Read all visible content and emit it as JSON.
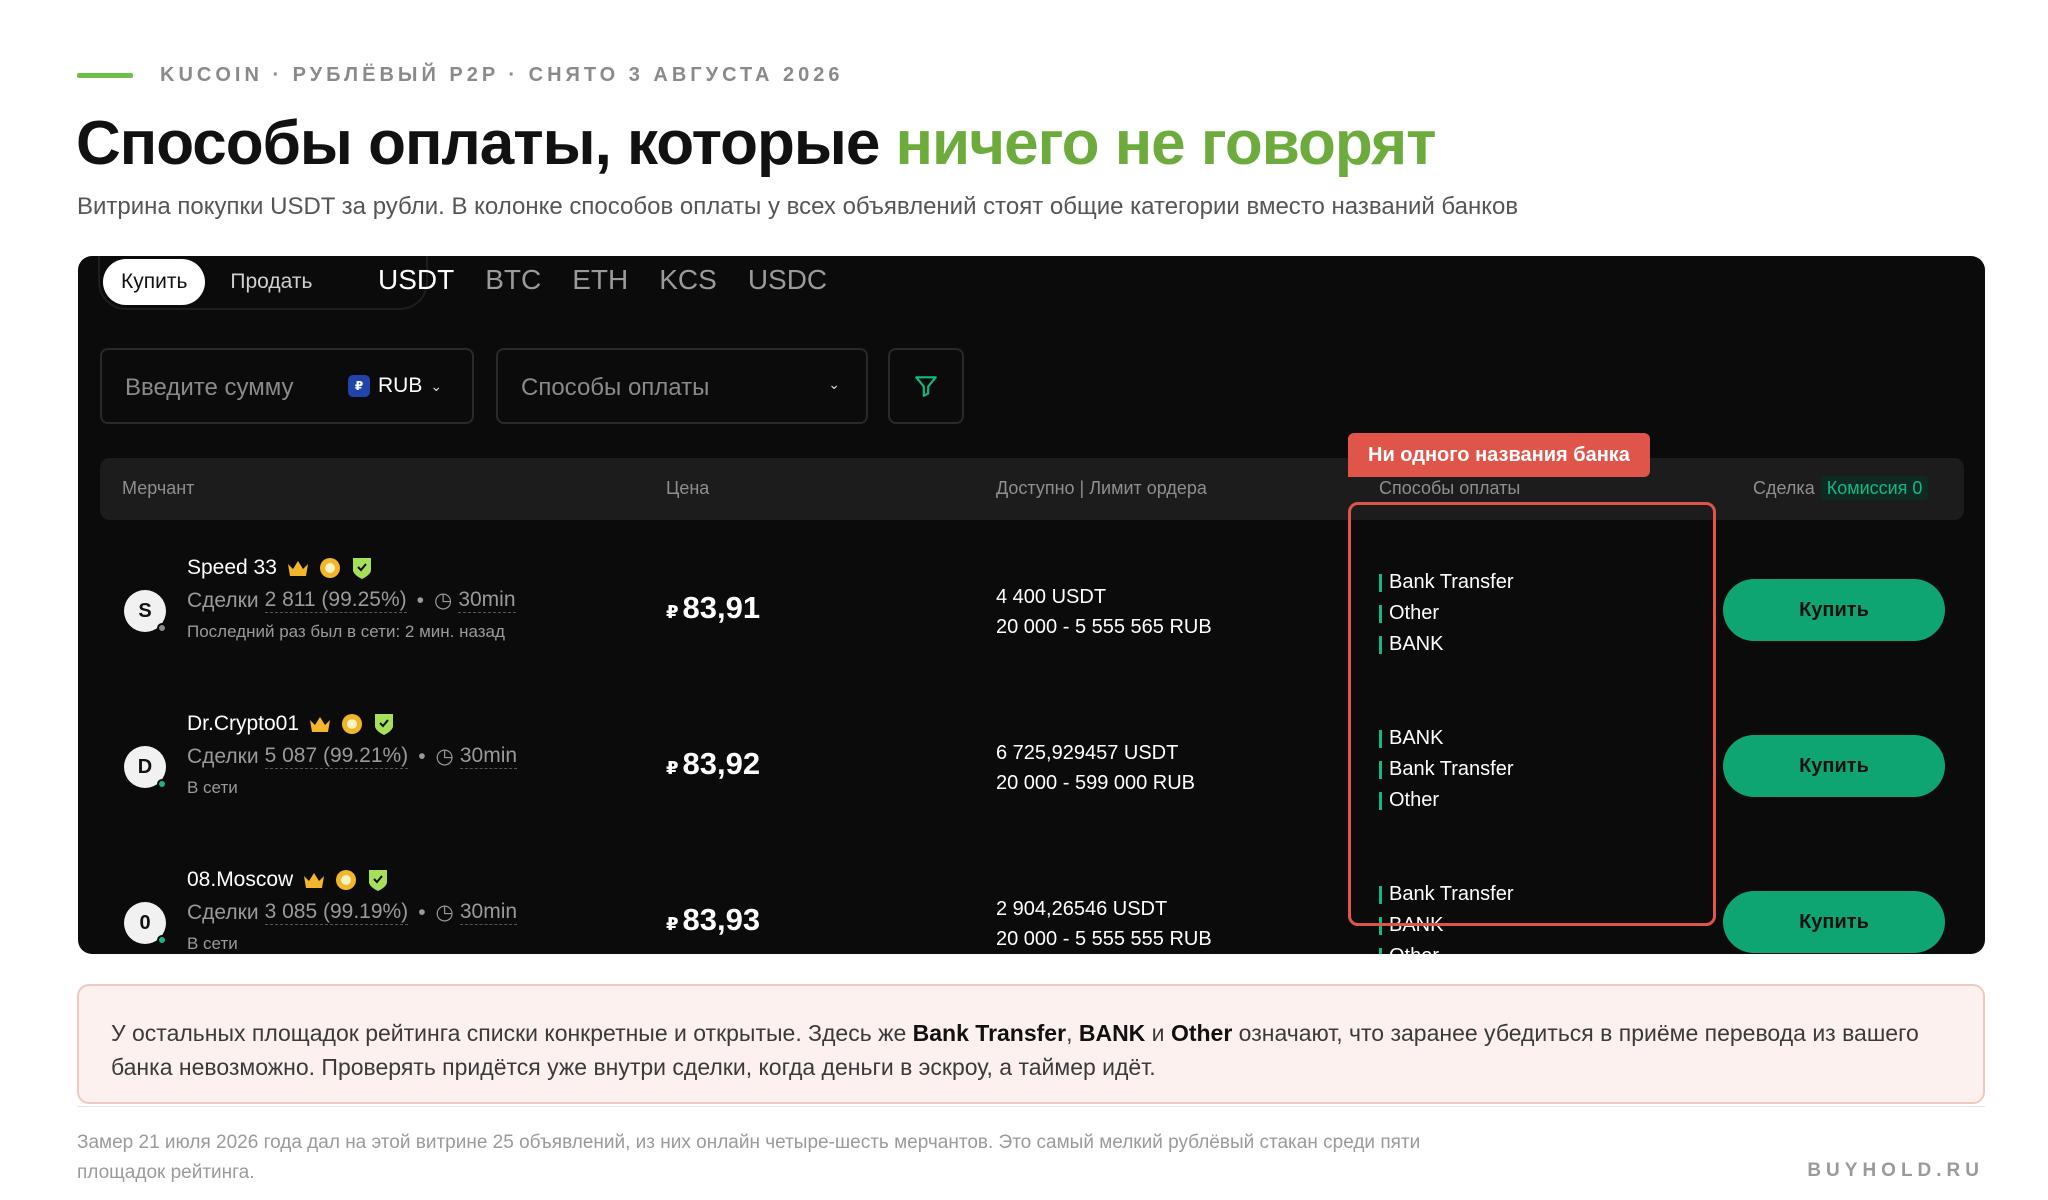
{
  "header": {
    "eyebrow": "KUCOIN · РУБЛЁВЫЙ P2P · СНЯТО 3 АВГУСТА 2026",
    "title_main": "Способы оплаты, которые ",
    "title_accent": "ничего не говорят",
    "subtitle": "Витрина покупки USDT за рубли. В колонке способов оплаты у всех объявлений стоят общие категории вместо названий банков"
  },
  "colors": {
    "accent_green": "#6cab3c",
    "buy_button": "#0fa572",
    "annotation_red": "#e0554a",
    "panel_bg": "#0b0b0b"
  },
  "trade": {
    "buy_label": "Купить",
    "sell_label": "Продать",
    "coins": [
      "USDT",
      "BTC",
      "ETH",
      "KCS",
      "USDC"
    ],
    "active_coin": "USDT"
  },
  "filters": {
    "amount_placeholder": "Введите сумму",
    "currency_badge": "₽",
    "currency": "RUB",
    "payment_placeholder": "Способы оплаты",
    "filter_icon": "funnel-icon"
  },
  "table": {
    "headers": {
      "merchant": "Мерчант",
      "price": "Цена",
      "available": "Доступно | Лимит ордера",
      "payment": "Способы оплаты",
      "deal": "Сделка",
      "fee": "Комиссия 0"
    },
    "rows": [
      {
        "initial": "S",
        "name": "Speed 33",
        "deals_label": "Сделки",
        "deals": "2 811 (99.25%)",
        "time": "30min",
        "status": "Последний раз был в сети: 2 мин. назад",
        "online": false,
        "price_symbol": "₽",
        "price": "83,91",
        "available": "4 400 USDT",
        "limit": "20 000 - 5 555 565 RUB",
        "methods": [
          "Bank Transfer",
          "Other",
          "BANK"
        ],
        "buy_label": "Купить"
      },
      {
        "initial": "D",
        "name": "Dr.Crypto01",
        "deals_label": "Сделки",
        "deals": "5 087 (99.21%)",
        "time": "30min",
        "status": "В сети",
        "online": true,
        "price_symbol": "₽",
        "price": "83,92",
        "available": "6 725,929457 USDT",
        "limit": "20 000 - 599 000 RUB",
        "methods": [
          "BANK",
          "Bank Transfer",
          "Other"
        ],
        "buy_label": "Купить"
      },
      {
        "initial": "0",
        "name": "08.Moscow",
        "deals_label": "Сделки",
        "deals": "3 085 (99.19%)",
        "time": "30min",
        "status": "В сети",
        "online": true,
        "price_symbol": "₽",
        "price": "83,93",
        "available": "2 904,26546 USDT",
        "limit": "20 000 - 5 555 555 RUB",
        "methods": [
          "Bank Transfer",
          "BANK",
          "Other"
        ],
        "buy_label": "Купить"
      }
    ]
  },
  "annotation": {
    "label": "Ни одного названия банка"
  },
  "note": {
    "part1": "У остальных площадок рейтинга списки конкретные и открытые. Здесь же ",
    "term1": "Bank Transfer",
    "comma": ", ",
    "term2": "BANK",
    "and": " и ",
    "term3": "Other",
    "part2": " означают, что заранее убедиться в приёме перевода из вашего банка невозможно. Проверять придётся уже внутри сделки, когда деньги в эскроу, а таймер идёт."
  },
  "footnote": "Замер 21 июля 2026 года дал на этой витрине 25 объявлений, из них онлайн четыре-шесть мерчантов. Это самый мелкий рублёвый стакан среди пяти площадок рейтинга.",
  "brand": "BUYHOLD.RU"
}
